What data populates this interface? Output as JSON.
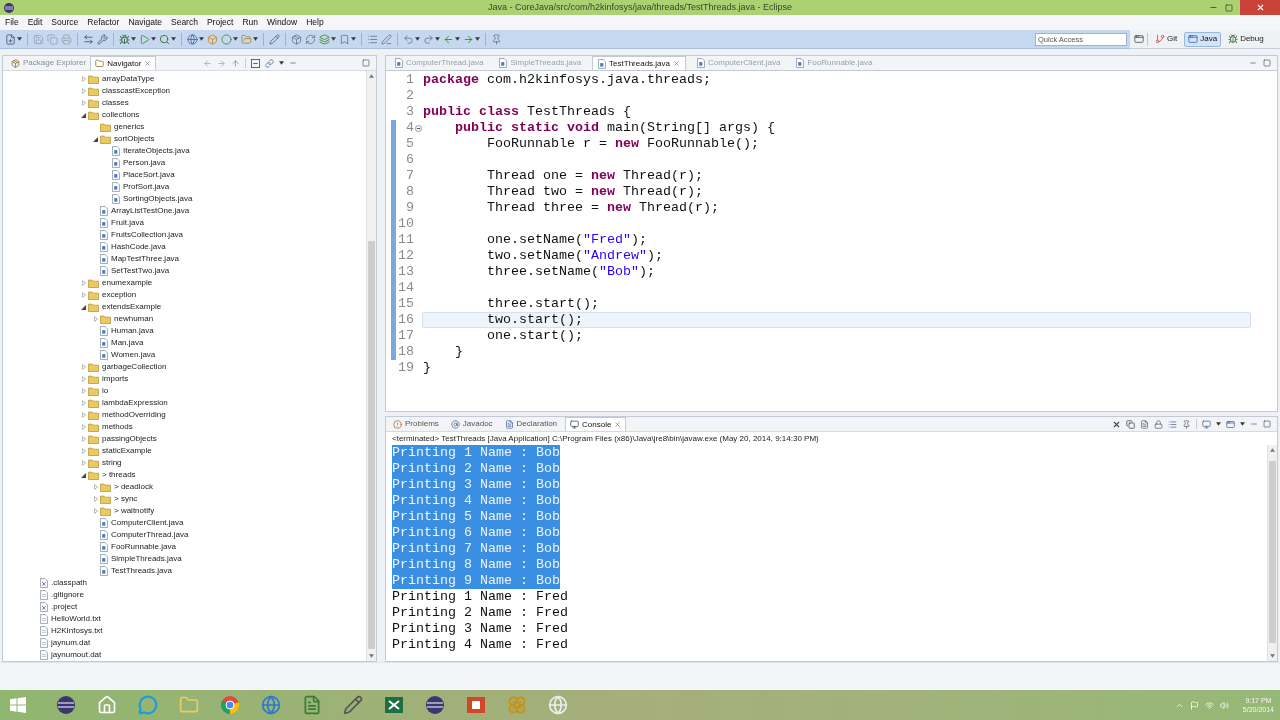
{
  "window": {
    "title": "Java - CoreJava/src/com/h2kinfosys/java/threads/TestThreads.java - Eclipse"
  },
  "menu": [
    "File",
    "Edit",
    "Source",
    "Refactor",
    "Navigate",
    "Search",
    "Project",
    "Run",
    "Window",
    "Help"
  ],
  "toolbar": {
    "quick_access": {
      "placeholder": "Quick Access"
    },
    "perspectives": [
      {
        "label": "Git",
        "selected": false
      },
      {
        "label": "Java",
        "selected": true
      },
      {
        "label": "Debug",
        "selected": false
      }
    ]
  },
  "left_panel": {
    "tabs": [
      {
        "label": "Package Explorer",
        "selected": false
      },
      {
        "label": "Navigator",
        "selected": true
      }
    ],
    "package_items": [
      {
        "label": "arrayDataType",
        "kind": "folder",
        "expanded": false
      },
      {
        "label": "classcastException",
        "kind": "folder",
        "expanded": false
      },
      {
        "label": "classes",
        "kind": "folder",
        "expanded": false
      },
      {
        "label": "collections",
        "kind": "folder",
        "expanded": true,
        "children": [
          {
            "label": "generics",
            "kind": "empty-folder"
          },
          {
            "label": "sortObjects",
            "kind": "folder",
            "expanded": true,
            "children": [
              {
                "label": "IterateObjects.java",
                "kind": "java"
              },
              {
                "label": "Person.java",
                "kind": "java"
              },
              {
                "label": "PlaceSort.java",
                "kind": "java"
              },
              {
                "label": "ProfSort.java",
                "kind": "java"
              },
              {
                "label": "SortingObjects.java",
                "kind": "java"
              }
            ]
          },
          {
            "label": "ArrayListTestOne.java",
            "kind": "java"
          },
          {
            "label": "Fruit.java",
            "kind": "java"
          },
          {
            "label": "FruitsCollection.java",
            "kind": "java"
          },
          {
            "label": "HashCode.java",
            "kind": "java"
          },
          {
            "label": "MapTestThree.java",
            "kind": "java"
          },
          {
            "label": "SetTestTwo.java",
            "kind": "java"
          }
        ]
      },
      {
        "label": "enumexample",
        "kind": "folder",
        "expanded": false
      },
      {
        "label": "exception",
        "kind": "folder",
        "expanded": false
      },
      {
        "label": "extendsExample",
        "kind": "folder",
        "expanded": true,
        "children": [
          {
            "label": "newhuman",
            "kind": "folder",
            "expanded": false
          },
          {
            "label": "Human.java",
            "kind": "java"
          },
          {
            "label": "Man.java",
            "kind": "java"
          },
          {
            "label": "Women.java",
            "kind": "java"
          }
        ]
      },
      {
        "label": "garbageCollection",
        "kind": "folder",
        "expanded": false
      },
      {
        "label": "imports",
        "kind": "folder",
        "expanded": false
      },
      {
        "label": "io",
        "kind": "folder",
        "expanded": false
      },
      {
        "label": "lambdaExpression",
        "kind": "folder",
        "expanded": false
      },
      {
        "label": "methodOverriding",
        "kind": "folder",
        "expanded": false
      },
      {
        "label": "methods",
        "kind": "folder",
        "expanded": false
      },
      {
        "label": "passingObjects",
        "kind": "folder",
        "expanded": false
      },
      {
        "label": "staticExample",
        "kind": "folder",
        "expanded": false
      },
      {
        "label": "string",
        "kind": "folder",
        "expanded": false
      },
      {
        "label": "> threads",
        "kind": "folder",
        "expanded": true,
        "children": [
          {
            "label": "> deadlock",
            "kind": "folder",
            "expanded": false
          },
          {
            "label": "> sync",
            "kind": "folder",
            "expanded": false
          },
          {
            "label": "> waitnotify",
            "kind": "folder",
            "expanded": false
          },
          {
            "label": "ComputerClient.java",
            "kind": "java"
          },
          {
            "label": "ComputerThread.java",
            "kind": "java"
          },
          {
            "label": "FooRunnable.java",
            "kind": "java"
          },
          {
            "label": "SimpleThreads.java",
            "kind": "java"
          },
          {
            "label": "TestThreads.java",
            "kind": "java"
          }
        ]
      }
    ],
    "project_files": [
      {
        "label": ".classpath",
        "kind": "config"
      },
      {
        "label": ".gitignore",
        "kind": "file"
      },
      {
        "label": ".project",
        "kind": "config"
      },
      {
        "label": "HelloWorld.txt",
        "kind": "file"
      },
      {
        "label": "H2KInfosys.txt",
        "kind": "file"
      },
      {
        "label": "jaynum.dat",
        "kind": "file"
      },
      {
        "label": "jaynumout.dat",
        "kind": "file"
      }
    ]
  },
  "editor": {
    "tabs": [
      {
        "label": "ComputerThread.java",
        "selected": false
      },
      {
        "label": "SimpleThreads.java",
        "selected": false
      },
      {
        "label": "TestThreads.java",
        "selected": true
      },
      {
        "label": "ComputerClient.java",
        "selected": false
      },
      {
        "label": "FooRunnable.java",
        "selected": false
      }
    ],
    "lines": [
      {
        "number": "1",
        "fold": false,
        "current": false,
        "in_range": false,
        "tokens": [
          {
            "kind": "keyword",
            "text": "package"
          },
          {
            "kind": "plain",
            "text": " com.h2kinfosys.java.threads;"
          }
        ]
      },
      {
        "number": "2",
        "fold": false,
        "current": false,
        "in_range": false
      },
      {
        "number": "3",
        "fold": false,
        "current": false,
        "in_range": false,
        "tokens": [
          {
            "kind": "keyword",
            "text": "public class"
          },
          {
            "kind": "plain",
            "text": " TestThreads {"
          }
        ]
      },
      {
        "number": "4",
        "fold": true,
        "current": false,
        "in_range": true,
        "tokens": [
          {
            "kind": "keyword",
            "text": "    public static void"
          },
          {
            "kind": "plain",
            "text": " main(String[] args) {"
          }
        ]
      },
      {
        "number": "5",
        "fold": false,
        "current": false,
        "in_range": true,
        "tokens": [
          {
            "kind": "plain",
            "text": "        FooRunnable r = "
          },
          {
            "kind": "keyword",
            "text": "new"
          },
          {
            "kind": "plain",
            "text": " FooRunnable();"
          }
        ]
      },
      {
        "number": "6",
        "fold": false,
        "current": false,
        "in_range": true
      },
      {
        "number": "7",
        "fold": false,
        "current": false,
        "in_range": true,
        "tokens": [
          {
            "kind": "plain",
            "text": "        Thread one = "
          },
          {
            "kind": "keyword",
            "text": "new"
          },
          {
            "kind": "plain",
            "text": " Thread(r);"
          }
        ]
      },
      {
        "number": "8",
        "fold": false,
        "current": false,
        "in_range": true,
        "tokens": [
          {
            "kind": "plain",
            "text": "        Thread two = "
          },
          {
            "kind": "keyword",
            "text": "new"
          },
          {
            "kind": "plain",
            "text": " Thread(r);"
          }
        ]
      },
      {
        "number": "9",
        "fold": false,
        "current": false,
        "in_range": true,
        "tokens": [
          {
            "kind": "plain",
            "text": "        Thread three = "
          },
          {
            "kind": "keyword",
            "text": "new"
          },
          {
            "kind": "plain",
            "text": " Thread(r);"
          }
        ]
      },
      {
        "number": "10",
        "fold": false,
        "current": false,
        "in_range": true
      },
      {
        "number": "11",
        "fold": false,
        "current": false,
        "in_range": true,
        "tokens": [
          {
            "kind": "plain",
            "text": "        one.setName("
          },
          {
            "kind": "string",
            "text": "\"Fred\""
          },
          {
            "kind": "plain",
            "text": ");"
          }
        ]
      },
      {
        "number": "12",
        "fold": false,
        "current": false,
        "in_range": true,
        "tokens": [
          {
            "kind": "plain",
            "text": "        two.setName("
          },
          {
            "kind": "string",
            "text": "\"Andrew\""
          },
          {
            "kind": "plain",
            "text": ");"
          }
        ]
      },
      {
        "number": "13",
        "fold": false,
        "current": false,
        "in_range": true,
        "tokens": [
          {
            "kind": "plain",
            "text": "        three.setName("
          },
          {
            "kind": "string",
            "text": "\"Bob\""
          },
          {
            "kind": "plain",
            "text": ");"
          }
        ]
      },
      {
        "number": "14",
        "fold": false,
        "current": false,
        "in_range": true
      },
      {
        "number": "15",
        "fold": false,
        "current": false,
        "in_range": true,
        "tokens": [
          {
            "kind": "plain",
            "text": "        three.start();"
          }
        ]
      },
      {
        "number": "16",
        "fold": false,
        "current": true,
        "in_range": true,
        "tokens": [
          {
            "kind": "plain",
            "text": "        two.start();"
          }
        ]
      },
      {
        "number": "17",
        "fold": false,
        "current": false,
        "in_range": true,
        "tokens": [
          {
            "kind": "plain",
            "text": "        one.start();"
          }
        ]
      },
      {
        "number": "18",
        "fold": false,
        "current": false,
        "in_range": true,
        "tokens": [
          {
            "kind": "plain",
            "text": "    }"
          }
        ]
      },
      {
        "number": "19",
        "fold": false,
        "current": false,
        "in_range": false,
        "tokens": [
          {
            "kind": "plain",
            "text": "}"
          }
        ]
      }
    ]
  },
  "console_panel": {
    "tabs": [
      {
        "label": "Problems",
        "selected": false
      },
      {
        "label": "Javadoc",
        "selected": false
      },
      {
        "label": "Declaration",
        "selected": false
      },
      {
        "label": "Console",
        "selected": true
      }
    ],
    "launch_info": "<terminated> TestThreads [Java Application] C:\\Program Files (x86)\\Java\\jre8\\bin\\javaw.exe (May 20, 2014, 9:14:30 PM)",
    "output": [
      {
        "text": "Printing 1 Name : Bob",
        "selected": true
      },
      {
        "text": "Printing 2 Name : Bob",
        "selected": true
      },
      {
        "text": "Printing 3 Name : Bob",
        "selected": true
      },
      {
        "text": "Printing 4 Name : Bob",
        "selected": true
      },
      {
        "text": "Printing 5 Name : Bob",
        "selected": true
      },
      {
        "text": "Printing 6 Name : Bob",
        "selected": true
      },
      {
        "text": "Printing 7 Name : Bob",
        "selected": true
      },
      {
        "text": "Printing 8 Name : Bob",
        "selected": true
      },
      {
        "text": "Printing 9 Name : Bob",
        "selected": true
      },
      {
        "text": "Printing 1 Name : Fred",
        "selected": false
      },
      {
        "text": "Printing 2 Name : Fred",
        "selected": false
      },
      {
        "text": "Printing 3 Name : Fred",
        "selected": false
      },
      {
        "text": "Printing 4 Name : Fred",
        "selected": false
      }
    ]
  },
  "taskbar": {
    "time": "9:17 PM",
    "date": "5/20/2014"
  }
}
